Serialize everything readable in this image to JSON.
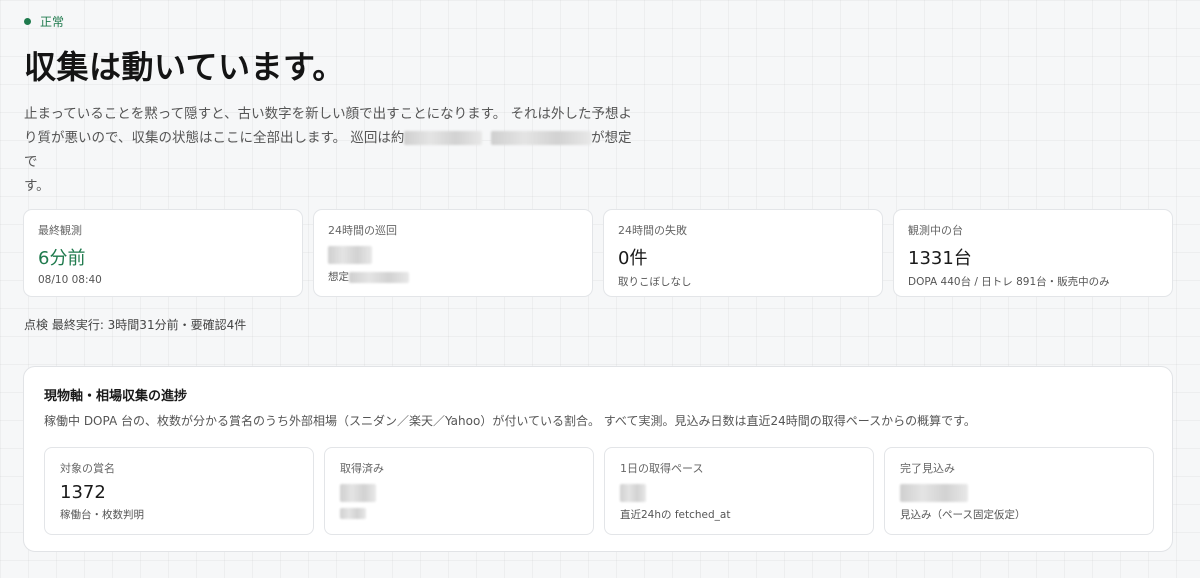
{
  "status": {
    "label": "正常",
    "color": "#1f7a4d"
  },
  "page_title": "収集は動いています。",
  "description": {
    "line1": "止まっていることを黙って隠すと、古い数字を新しい顔で出すことになります。 それは外した予想よ",
    "line2_prefix": "り質が悪いので、収集の状態はここに全部出します。 巡回は約",
    "line2_suffix": "が想定で",
    "line3": "す。"
  },
  "stats": [
    {
      "label": "最終観測",
      "value": "6分前",
      "sub": "08/10 08:40"
    },
    {
      "label": "24時間の巡回",
      "value": "",
      "sub": "想定"
    },
    {
      "label": "24時間の失敗",
      "value": "0件",
      "sub": "取りこぼしなし"
    },
    {
      "label": "観測中の台",
      "value": "1331台",
      "sub": "DOPA 440台 / 日トレ 891台・販売中のみ"
    }
  ],
  "check_line": "点検 最終実行: 3時間31分前・要確認4件",
  "progress": {
    "title": "現物軸・相場収集の進捗",
    "description": "稼働中 DOPA 台の、枚数が分かる賞名のうち外部相場（スニダン／楽天／Yahoo）が付いている割合。 すべて実測。見込み日数は直近24時間の取得ペースからの概算です。",
    "cards": [
      {
        "label": "対象の賞名",
        "value": "1372",
        "sub": "稼働台・枚数判明"
      },
      {
        "label": "取得済み",
        "value": "",
        "sub": ""
      },
      {
        "label": "1日の取得ペース",
        "value": "",
        "sub": "直近24hの fetched_at"
      },
      {
        "label": "完了見込み",
        "value": "",
        "sub": "見込み（ペース固定仮定）"
      }
    ]
  }
}
